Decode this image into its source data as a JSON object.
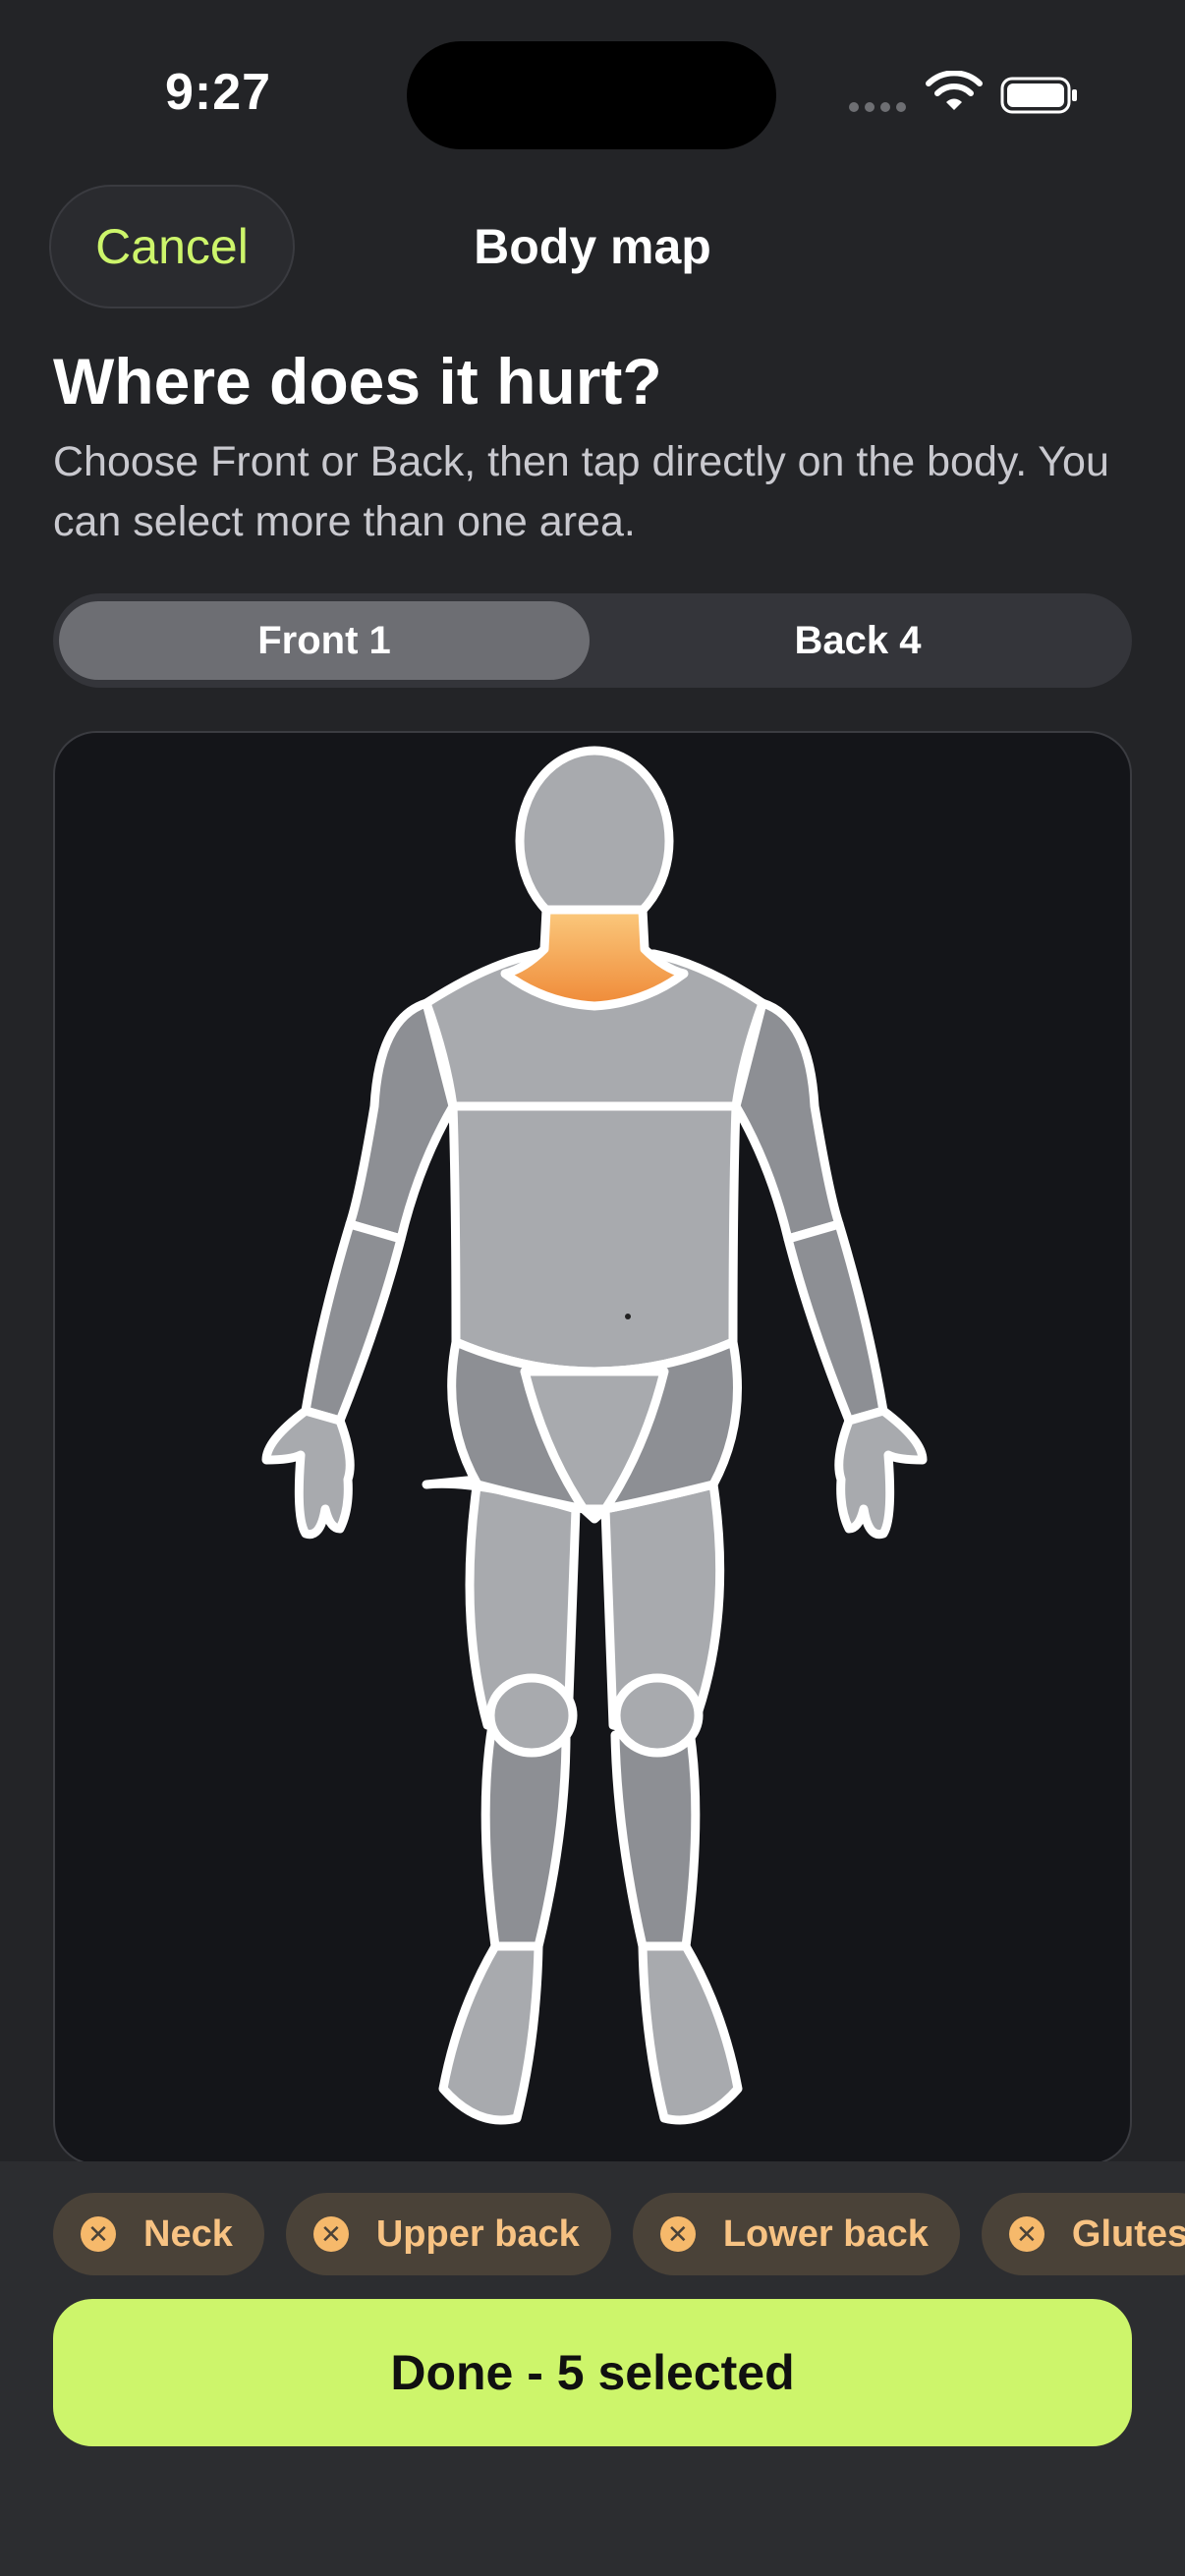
{
  "status_bar": {
    "time": "9:27"
  },
  "nav": {
    "cancel_label": "Cancel",
    "title": "Body map"
  },
  "header": {
    "headline": "Where does it hurt?",
    "subtitle": "Choose Front or Back, then tap directly on the body. You can select more than one area."
  },
  "segments": {
    "front_label": "Front 1",
    "back_label": "Back 4",
    "selected": "front"
  },
  "selected_chips": [
    {
      "label": "Neck",
      "icon": "close-icon"
    },
    {
      "label": "Upper back",
      "icon": "close-icon"
    },
    {
      "label": "Lower back",
      "icon": "close-icon"
    },
    {
      "label": "Glutes",
      "icon": "close-icon"
    }
  ],
  "done_button": {
    "label": "Done - 5 selected"
  },
  "colors": {
    "accent": "#cdf56b",
    "highlight": "#f5a552",
    "chip_bg": "#4a4238",
    "chip_text": "#f8c383",
    "body_fill": "#a8aaae",
    "body_dark": "#8d8f94"
  }
}
